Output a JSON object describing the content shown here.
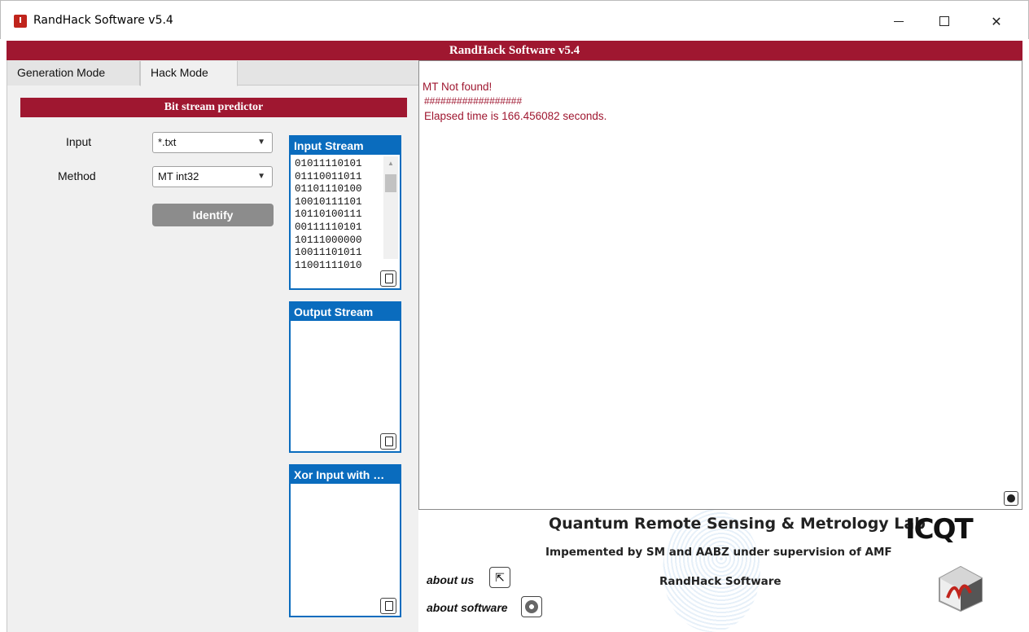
{
  "window": {
    "title": "RandHack Software v5.4",
    "min_glyph": "",
    "close_glyph": "✕"
  },
  "banner": {
    "title": "RandHack Software v5.4"
  },
  "tabs": [
    {
      "label": "Generation Mode",
      "active": false
    },
    {
      "label": "Hack Mode",
      "active": true
    }
  ],
  "predictor": {
    "section_title": "Bit stream predictor",
    "input_label": "Input",
    "input_value": "*.txt",
    "method_label": "Method",
    "method_value": "MT int32",
    "identify_label": "Identify",
    "dropdown_arrow": "▼"
  },
  "streams": {
    "input": {
      "title": "Input Stream",
      "lines": [
        "01011110101",
        "01110011011",
        "01101110100",
        "10010111101",
        "10110100111",
        "00111110101",
        "10111000000",
        "10011101011",
        "11001111010"
      ]
    },
    "output": {
      "title": "Output Stream"
    },
    "xor": {
      "title": "Xor Input with …"
    },
    "txt_icon_label": "txt"
  },
  "log": {
    "lines": [
      "  MT Not found!",
      "##################",
      "Elapsed time is 166.456082 seconds."
    ]
  },
  "footer": {
    "lab_name": "Quantum Remote Sensing & Metrology Lab",
    "implemented_by": "Impemented by SM and AABZ under supervision of AMF",
    "software_name": "RandHack Software",
    "logo_text": "ICQT",
    "about_us_label": "about us",
    "about_software_label": "about software",
    "about_us_glyph": "⇱"
  },
  "colors": {
    "accent": "#9f1730",
    "stream_blue": "#0a6cbe",
    "button_gray": "#8c8c8c"
  }
}
